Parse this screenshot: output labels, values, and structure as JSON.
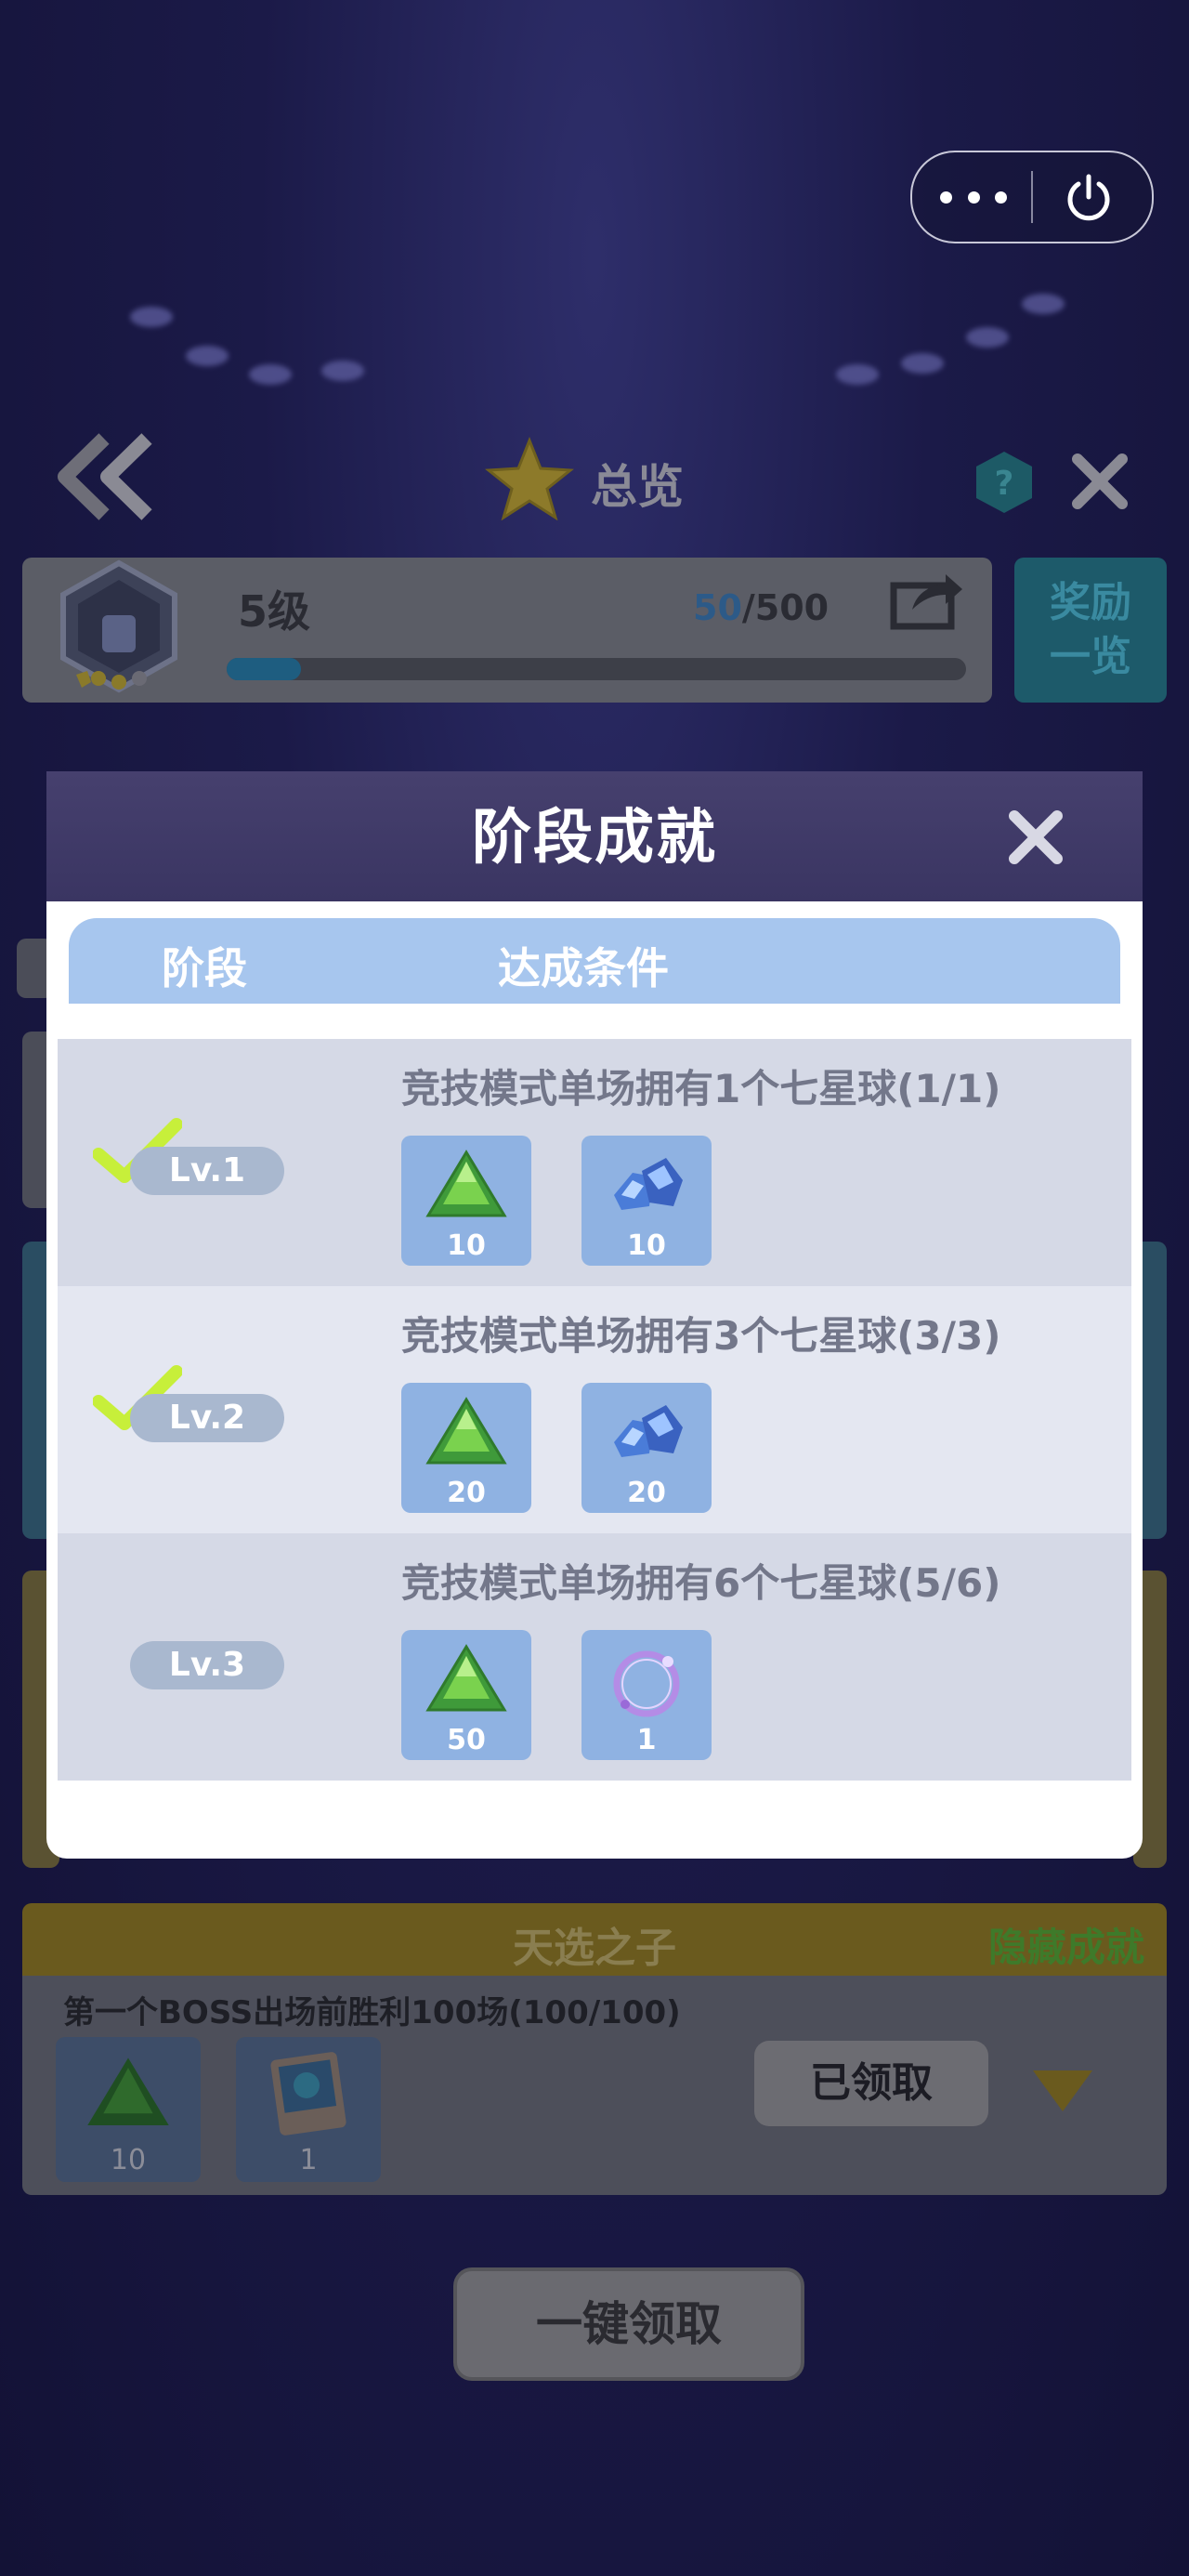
{
  "header": {
    "title": "总览"
  },
  "level": {
    "label": "5级",
    "progress_current": "50",
    "progress_total": "/500",
    "progress_fraction": 0.1,
    "reward_button": "奖励一览"
  },
  "modal": {
    "title": "阶段成就",
    "col_stage": "阶段",
    "col_condition": "达成条件",
    "rows": [
      {
        "level": "Lv.1",
        "condition": "竞技模式单场拥有1个七星球(1/1)",
        "completed": true,
        "rewards": [
          {
            "icon": "green-gem-icon",
            "qty": "10"
          },
          {
            "icon": "blue-crystal-icon",
            "qty": "10"
          }
        ]
      },
      {
        "level": "Lv.2",
        "condition": "竞技模式单场拥有3个七星球(3/3)",
        "completed": true,
        "rewards": [
          {
            "icon": "green-gem-icon",
            "qty": "20"
          },
          {
            "icon": "blue-crystal-icon",
            "qty": "20"
          }
        ]
      },
      {
        "level": "Lv.3",
        "condition": "竞技模式单场拥有6个七星球(5/6)",
        "completed": false,
        "rewards": [
          {
            "icon": "green-gem-icon",
            "qty": "50"
          },
          {
            "icon": "purple-ring-icon",
            "qty": "1"
          }
        ]
      }
    ]
  },
  "background_card": {
    "title": "天选之子",
    "tag": "隐藏成就",
    "description": "第一个BOSS出场前胜利100场(100/100)",
    "rewards": [
      {
        "icon": "green-gem-icon",
        "qty": "10"
      },
      {
        "icon": "avatar-card-icon",
        "qty": "1"
      }
    ],
    "claimed_label": "已领取"
  },
  "claim_all_label": "一键领取",
  "colors": {
    "modal_header": "#3a3562",
    "table_head": "#a7c6ee",
    "reward_tile": "#8fb2e2",
    "check": "#c7ef3a"
  }
}
